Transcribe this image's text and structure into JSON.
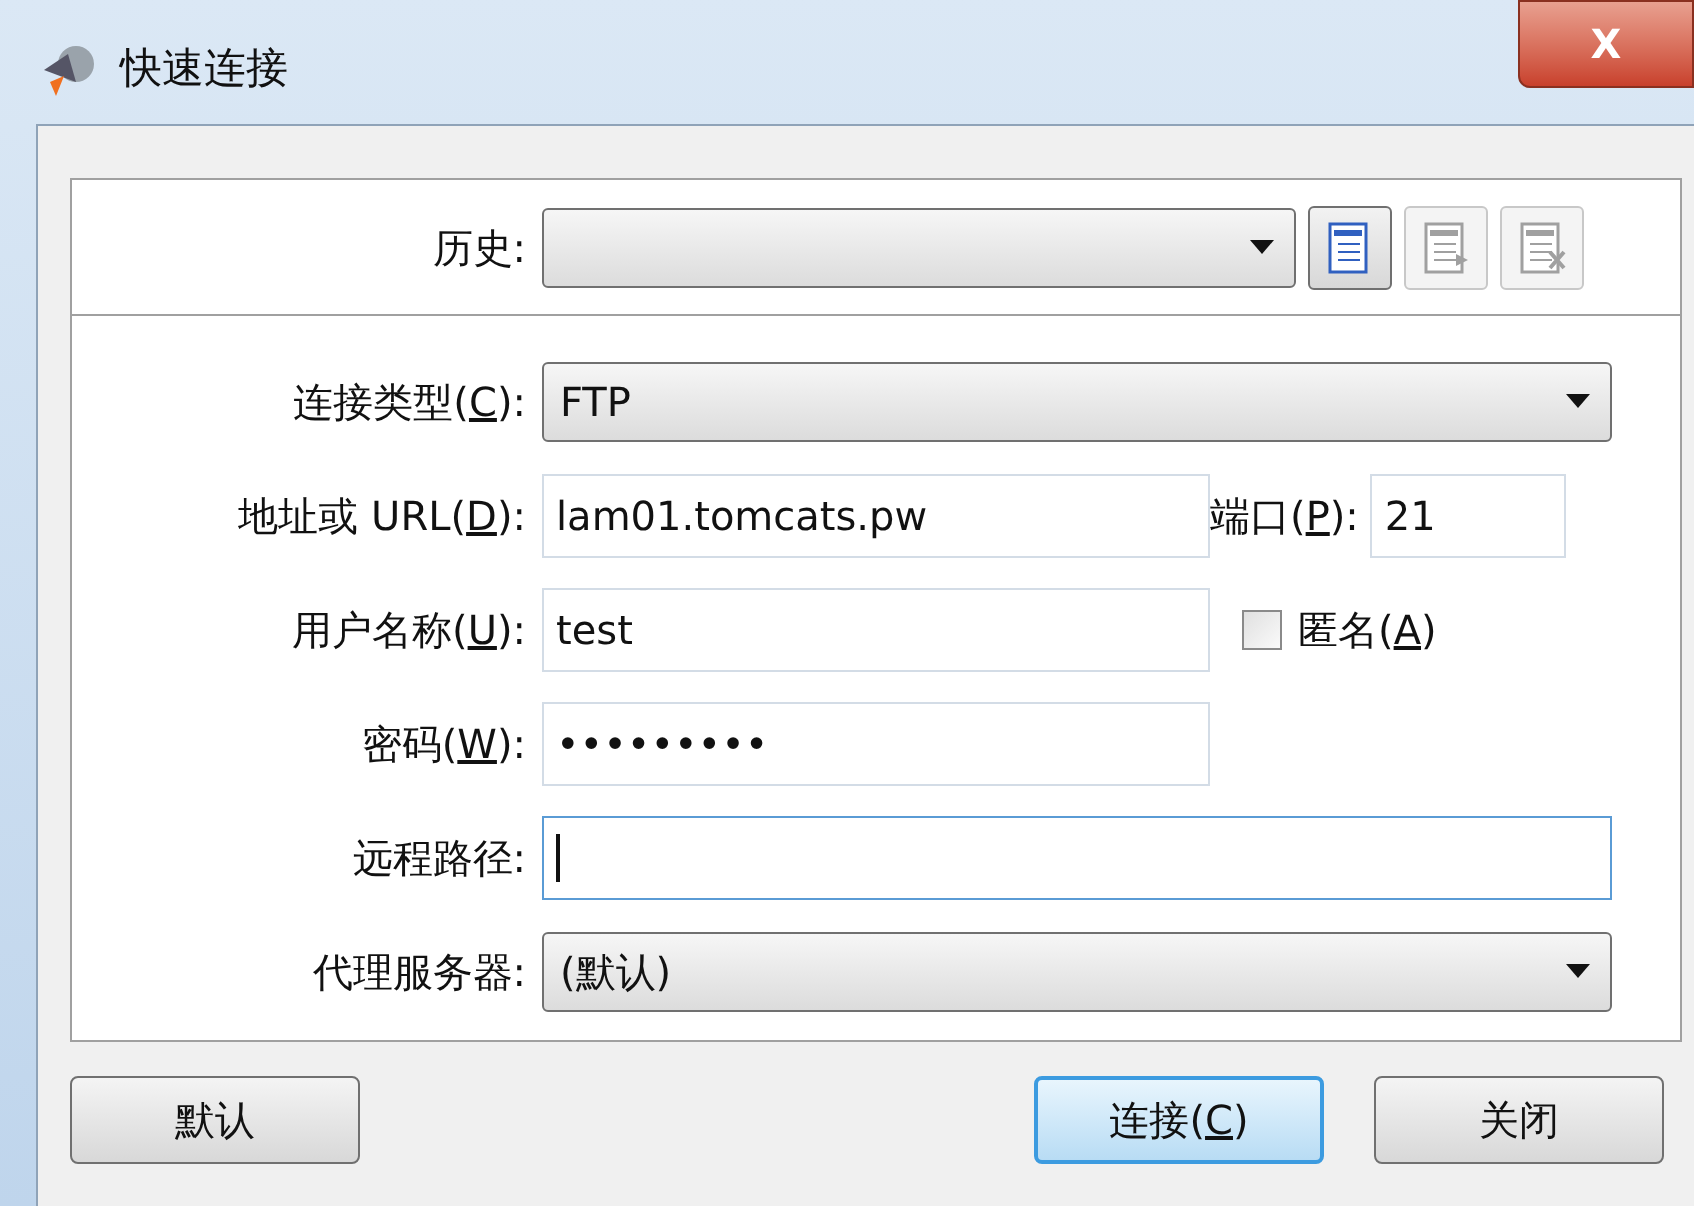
{
  "window": {
    "title": "快速连接",
    "close": "X"
  },
  "history": {
    "label": "历史:",
    "buttons": [
      {
        "disabled": false
      },
      {
        "disabled": true
      },
      {
        "disabled": true
      }
    ]
  },
  "fields": [
    {
      "kind": "dropdown",
      "label": {
        "before": "连接类型(",
        "mnemonic": "C",
        "after": "):"
      },
      "value": "FTP"
    },
    {
      "kind": "text",
      "label": {
        "before": "地址或 URL(",
        "mnemonic": "D",
        "after": "):"
      },
      "value": "lam01.tomcats.pw",
      "port": {
        "label": {
          "before": "端口(",
          "mnemonic": "P",
          "after": "):"
        },
        "value": "21"
      }
    },
    {
      "kind": "text",
      "label": {
        "before": "用户名称(",
        "mnemonic": "U",
        "after": "):"
      },
      "value": "test",
      "checkbox": {
        "label": {
          "before": "匿名(",
          "mnemonic": "A",
          "after": ")"
        },
        "checked": false
      }
    },
    {
      "kind": "text",
      "label": {
        "before": "密码(",
        "mnemonic": "W",
        "after": "):"
      },
      "value": "•••••••••"
    },
    {
      "kind": "wide",
      "label": {
        "before": "远程路径:"
      },
      "focused": true
    },
    {
      "kind": "dropdown",
      "label": {
        "before": "代理服务器:"
      },
      "value": "(默认)"
    }
  ],
  "buttons": [
    {
      "label": {
        "before": "默认"
      },
      "default": false
    },
    {
      "label": {
        "before": "连接(",
        "mnemonic": "C",
        "after": ")"
      },
      "default": true
    },
    {
      "label": {
        "before": "关闭"
      },
      "default": false
    }
  ]
}
